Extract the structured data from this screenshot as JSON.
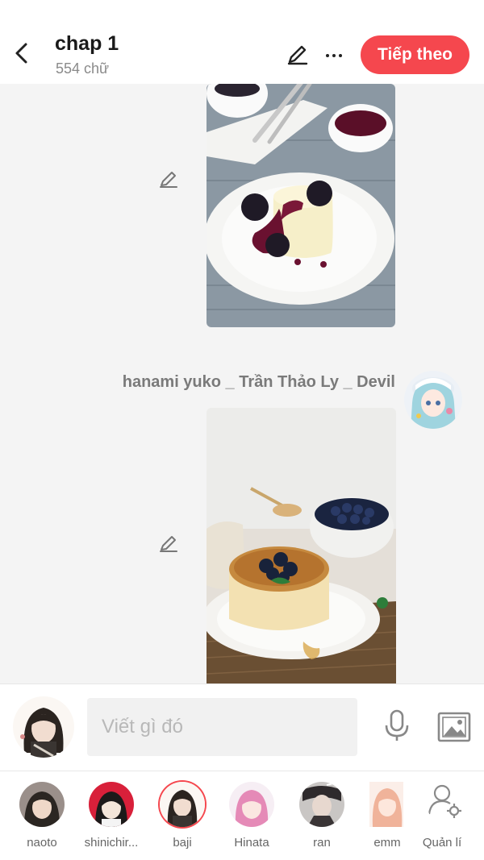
{
  "header": {
    "title": "chap 1",
    "word_count": "554 chữ",
    "next_label": "Tiếp theo"
  },
  "messages": [
    {
      "type": "image",
      "image": "panna-cotta-blackberries-photo"
    },
    {
      "type": "image",
      "author": "hanami yuko _ Trần Thảo Ly _ Devil",
      "image": "blueberry-cheesecake-photo"
    }
  ],
  "composer": {
    "placeholder": "Viết gì đó"
  },
  "characters": [
    {
      "name": "naoto"
    },
    {
      "name": "shinichir..."
    },
    {
      "name": "baji",
      "selected": true
    },
    {
      "name": "Hinata"
    },
    {
      "name": "ran"
    },
    {
      "name": "emm"
    },
    {
      "name": "Quản lí"
    }
  ],
  "colors": {
    "accent": "#f5474e",
    "background": "#f4f4f4"
  }
}
